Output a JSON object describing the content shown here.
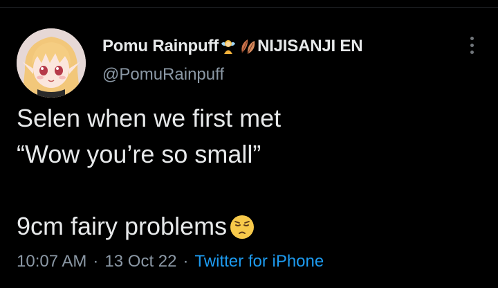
{
  "tweet": {
    "author": {
      "display_name": "Pomu Rainpuff",
      "name_suffix": "NIJISANJI EN",
      "name_emojis": [
        "fairy-emoji",
        "leaf-emoji"
      ],
      "handle": "@PomuRainpuff"
    },
    "body_lines": [
      "Selen when we first met",
      "“Wow you’re so small”",
      "",
      "9cm fairy problems"
    ],
    "body_end_emoji": "pensive-face-emoji",
    "time": "10:07 AM",
    "date": "13 Oct 22",
    "separator": "·",
    "source": "Twitter for iPhone"
  },
  "colors": {
    "background": "#000000",
    "text": "#e7e9ea",
    "secondary": "#8b98a5",
    "link": "#1d9bf0"
  },
  "icons": {
    "more": "more-vertical-icon"
  }
}
